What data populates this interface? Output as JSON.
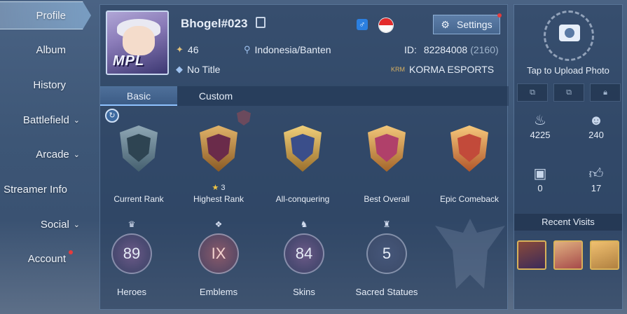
{
  "sidebar": {
    "items": [
      {
        "label": "Profile",
        "active": true
      },
      {
        "label": "Album"
      },
      {
        "label": "History"
      },
      {
        "label": "Battlefield",
        "chevron": "⌄"
      },
      {
        "label": "Arcade",
        "chevron": "⌄"
      },
      {
        "label": "Streamer Info"
      },
      {
        "label": "Social",
        "chevron": "⌄"
      },
      {
        "label": "Account",
        "notify": true
      }
    ]
  },
  "profile": {
    "username": "Bhogel#023",
    "avatar_text": "MPL",
    "level": "46",
    "location": "Indonesia/Banten",
    "id_label": "ID:",
    "id_value": "82284008",
    "server": "(2160)",
    "title": "No Title",
    "team_tag": "KRM",
    "team_name": "KORMA ESPORTS",
    "settings_label": "Settings",
    "gender_symbol": "♂"
  },
  "tabs": [
    {
      "label": "Basic",
      "active": true
    },
    {
      "label": "Custom"
    }
  ],
  "badges": [
    {
      "label": "Current Rank",
      "color": "#5e7a8a"
    },
    {
      "label": "Highest Rank",
      "stars": "3",
      "color": "#c08a3e"
    },
    {
      "label": "All-conquering",
      "color": "#c9a14a"
    },
    {
      "label": "Best Overall",
      "color": "#c58a3c"
    },
    {
      "label": "Epic Comeback",
      "color": "#c86b3a"
    }
  ],
  "stats": [
    {
      "label": "Heroes",
      "value": "89"
    },
    {
      "label": "Emblems",
      "value": "IX"
    },
    {
      "label": "Skins",
      "value": "84"
    },
    {
      "label": "Sacred Statues",
      "value": "5"
    }
  ],
  "right_panel": {
    "upload_text": "Tap to Upload Photo",
    "popularity": "4225",
    "followers": "240",
    "gifts": "0",
    "likes": "17",
    "recent_title": "Recent Visits"
  }
}
